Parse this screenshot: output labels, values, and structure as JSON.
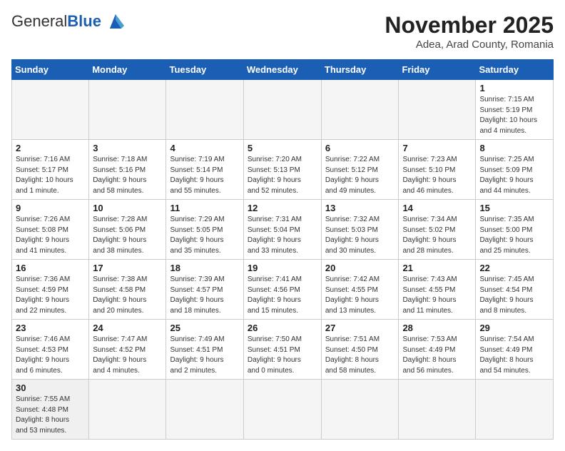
{
  "logo": {
    "general": "General",
    "blue": "Blue"
  },
  "header": {
    "title": "November 2025",
    "subtitle": "Adea, Arad County, Romania"
  },
  "weekdays": [
    "Sunday",
    "Monday",
    "Tuesday",
    "Wednesday",
    "Thursday",
    "Friday",
    "Saturday"
  ],
  "weeks": [
    [
      {
        "day": "",
        "info": ""
      },
      {
        "day": "",
        "info": ""
      },
      {
        "day": "",
        "info": ""
      },
      {
        "day": "",
        "info": ""
      },
      {
        "day": "",
        "info": ""
      },
      {
        "day": "",
        "info": ""
      },
      {
        "day": "1",
        "info": "Sunrise: 7:15 AM\nSunset: 5:19 PM\nDaylight: 10 hours\nand 4 minutes."
      }
    ],
    [
      {
        "day": "2",
        "info": "Sunrise: 7:16 AM\nSunset: 5:17 PM\nDaylight: 10 hours\nand 1 minute."
      },
      {
        "day": "3",
        "info": "Sunrise: 7:18 AM\nSunset: 5:16 PM\nDaylight: 9 hours\nand 58 minutes."
      },
      {
        "day": "4",
        "info": "Sunrise: 7:19 AM\nSunset: 5:14 PM\nDaylight: 9 hours\nand 55 minutes."
      },
      {
        "day": "5",
        "info": "Sunrise: 7:20 AM\nSunset: 5:13 PM\nDaylight: 9 hours\nand 52 minutes."
      },
      {
        "day": "6",
        "info": "Sunrise: 7:22 AM\nSunset: 5:12 PM\nDaylight: 9 hours\nand 49 minutes."
      },
      {
        "day": "7",
        "info": "Sunrise: 7:23 AM\nSunset: 5:10 PM\nDaylight: 9 hours\nand 46 minutes."
      },
      {
        "day": "8",
        "info": "Sunrise: 7:25 AM\nSunset: 5:09 PM\nDaylight: 9 hours\nand 44 minutes."
      }
    ],
    [
      {
        "day": "9",
        "info": "Sunrise: 7:26 AM\nSunset: 5:08 PM\nDaylight: 9 hours\nand 41 minutes."
      },
      {
        "day": "10",
        "info": "Sunrise: 7:28 AM\nSunset: 5:06 PM\nDaylight: 9 hours\nand 38 minutes."
      },
      {
        "day": "11",
        "info": "Sunrise: 7:29 AM\nSunset: 5:05 PM\nDaylight: 9 hours\nand 35 minutes."
      },
      {
        "day": "12",
        "info": "Sunrise: 7:31 AM\nSunset: 5:04 PM\nDaylight: 9 hours\nand 33 minutes."
      },
      {
        "day": "13",
        "info": "Sunrise: 7:32 AM\nSunset: 5:03 PM\nDaylight: 9 hours\nand 30 minutes."
      },
      {
        "day": "14",
        "info": "Sunrise: 7:34 AM\nSunset: 5:02 PM\nDaylight: 9 hours\nand 28 minutes."
      },
      {
        "day": "15",
        "info": "Sunrise: 7:35 AM\nSunset: 5:00 PM\nDaylight: 9 hours\nand 25 minutes."
      }
    ],
    [
      {
        "day": "16",
        "info": "Sunrise: 7:36 AM\nSunset: 4:59 PM\nDaylight: 9 hours\nand 22 minutes."
      },
      {
        "day": "17",
        "info": "Sunrise: 7:38 AM\nSunset: 4:58 PM\nDaylight: 9 hours\nand 20 minutes."
      },
      {
        "day": "18",
        "info": "Sunrise: 7:39 AM\nSunset: 4:57 PM\nDaylight: 9 hours\nand 18 minutes."
      },
      {
        "day": "19",
        "info": "Sunrise: 7:41 AM\nSunset: 4:56 PM\nDaylight: 9 hours\nand 15 minutes."
      },
      {
        "day": "20",
        "info": "Sunrise: 7:42 AM\nSunset: 4:55 PM\nDaylight: 9 hours\nand 13 minutes."
      },
      {
        "day": "21",
        "info": "Sunrise: 7:43 AM\nSunset: 4:55 PM\nDaylight: 9 hours\nand 11 minutes."
      },
      {
        "day": "22",
        "info": "Sunrise: 7:45 AM\nSunset: 4:54 PM\nDaylight: 9 hours\nand 8 minutes."
      }
    ],
    [
      {
        "day": "23",
        "info": "Sunrise: 7:46 AM\nSunset: 4:53 PM\nDaylight: 9 hours\nand 6 minutes."
      },
      {
        "day": "24",
        "info": "Sunrise: 7:47 AM\nSunset: 4:52 PM\nDaylight: 9 hours\nand 4 minutes."
      },
      {
        "day": "25",
        "info": "Sunrise: 7:49 AM\nSunset: 4:51 PM\nDaylight: 9 hours\nand 2 minutes."
      },
      {
        "day": "26",
        "info": "Sunrise: 7:50 AM\nSunset: 4:51 PM\nDaylight: 9 hours\nand 0 minutes."
      },
      {
        "day": "27",
        "info": "Sunrise: 7:51 AM\nSunset: 4:50 PM\nDaylight: 8 hours\nand 58 minutes."
      },
      {
        "day": "28",
        "info": "Sunrise: 7:53 AM\nSunset: 4:49 PM\nDaylight: 8 hours\nand 56 minutes."
      },
      {
        "day": "29",
        "info": "Sunrise: 7:54 AM\nSunset: 4:49 PM\nDaylight: 8 hours\nand 54 minutes."
      }
    ],
    [
      {
        "day": "30",
        "info": "Sunrise: 7:55 AM\nSunset: 4:48 PM\nDaylight: 8 hours\nand 53 minutes."
      },
      {
        "day": "",
        "info": ""
      },
      {
        "day": "",
        "info": ""
      },
      {
        "day": "",
        "info": ""
      },
      {
        "day": "",
        "info": ""
      },
      {
        "day": "",
        "info": ""
      },
      {
        "day": "",
        "info": ""
      }
    ]
  ]
}
